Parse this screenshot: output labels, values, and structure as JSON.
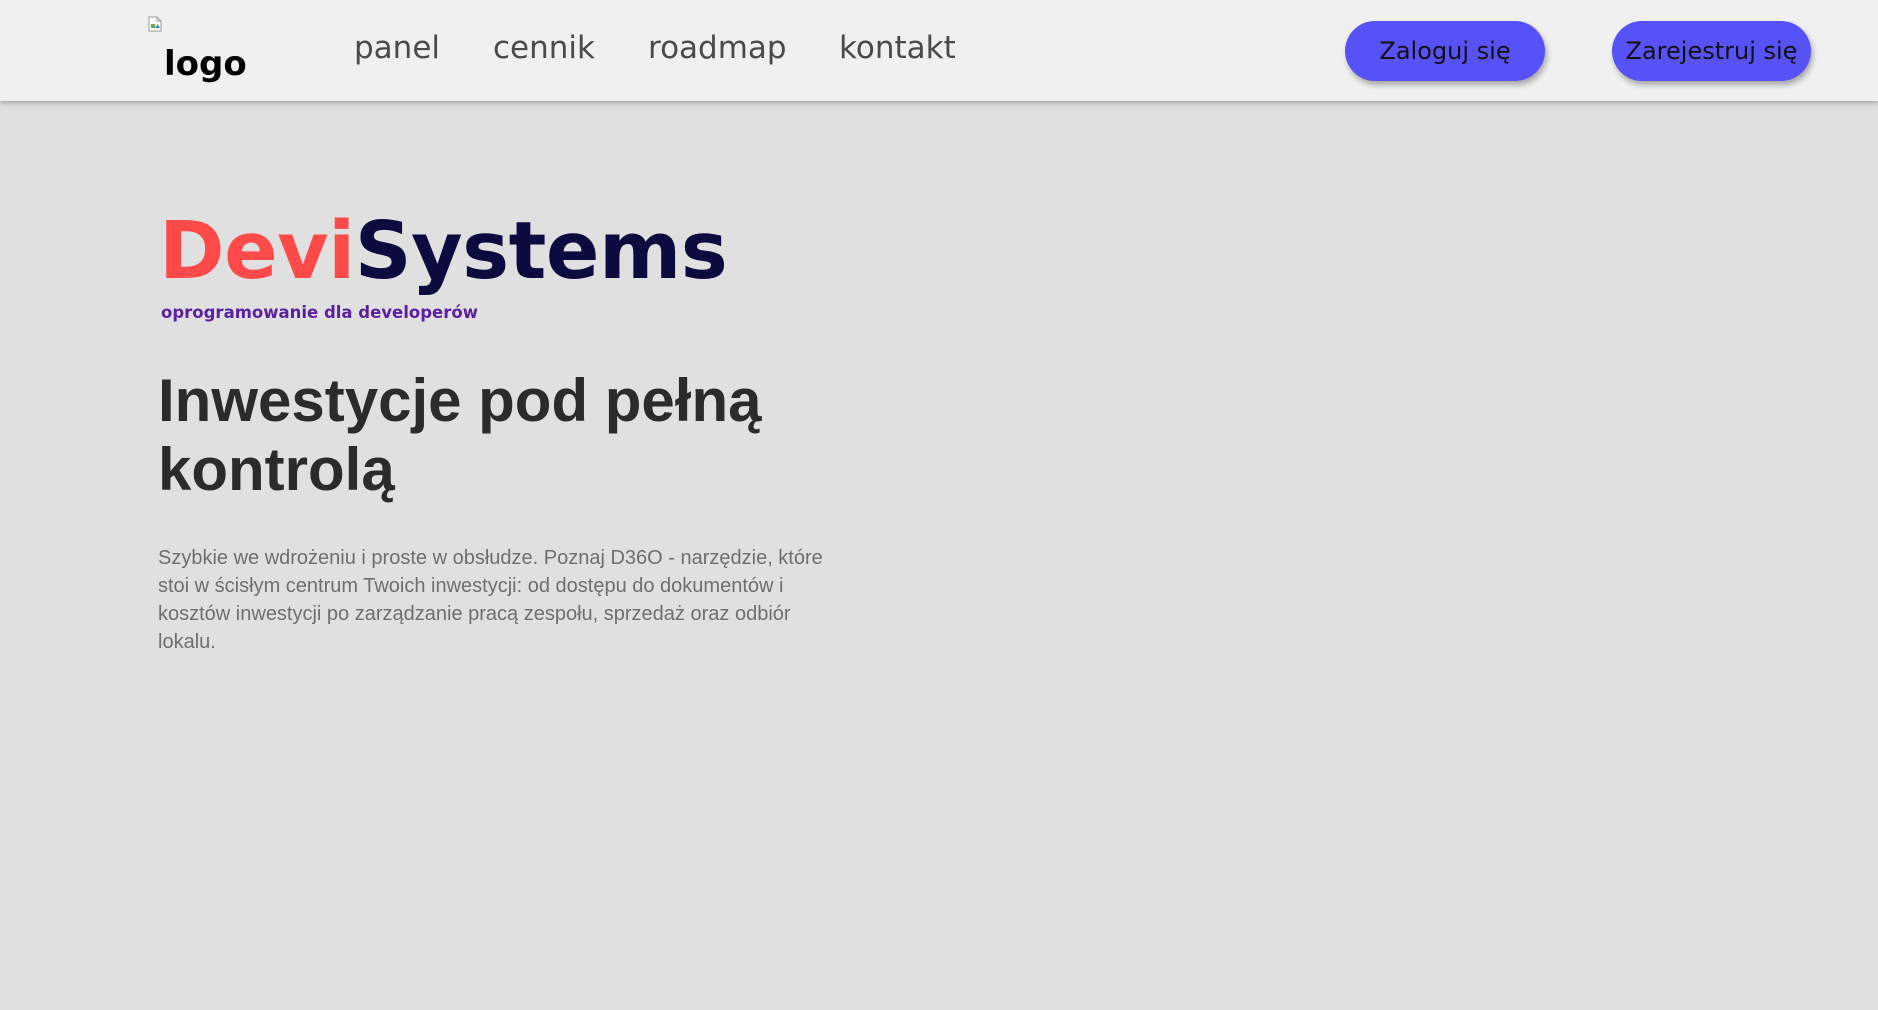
{
  "header": {
    "logo_alt": "logo",
    "nav": {
      "panel": "panel",
      "cennik": "cennik",
      "roadmap": "roadmap",
      "kontakt": "kontakt"
    },
    "login_label": "Zaloguj się",
    "register_label": "Zarejestruj się"
  },
  "hero": {
    "brand_part1": "Devi",
    "brand_part2": "Systems",
    "tagline": "oprogramowanie dla developerów",
    "headline": "Inwestycje pod pełną kontrolą",
    "description": "Szybkie we wdrożeniu i proste w obsłudze. Poznaj D36O - narzędzie, które stoi w ścisłym centrum Twoich inwestycji: od dostępu do dokumentów i kosztów inwestycji po zarządzanie pracą zespołu, sprzedaż oraz odbiór lokalu."
  },
  "colors": {
    "page_background": "#e0e0e0",
    "navbar_background": "#f0f0f0",
    "button": "#5652f7",
    "brand_devi": "#ff4a4a",
    "brand_systems": "#0c0a3e",
    "tagline": "#5b1fa3",
    "headline": "#2b2b2b",
    "description": "#6e6e6e"
  },
  "icons": {
    "logo": "broken-image-icon"
  }
}
